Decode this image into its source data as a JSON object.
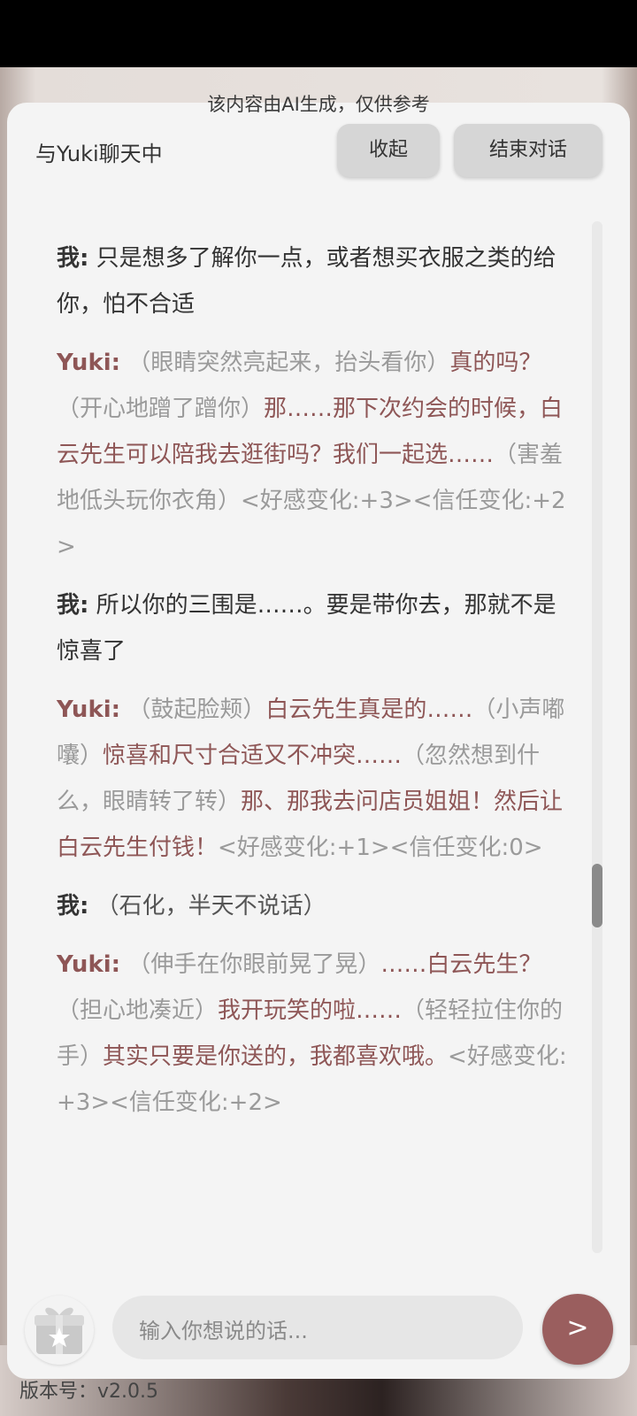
{
  "ai_notice": "该内容由AI生成，仅供参考",
  "header": {
    "title": "与Yuki聊天中",
    "collapse_label": "收起",
    "end_label": "结束对话"
  },
  "messages": [
    {
      "speaker": "我:",
      "role": "me",
      "parts": [
        {
          "type": "speech",
          "text": "只是想多了解你一点，或者想买衣服之类的给你，怕不合适"
        }
      ]
    },
    {
      "speaker": "Yuki:",
      "role": "yuki",
      "parts": [
        {
          "type": "action",
          "text": "（眼睛突然亮起来，抬头看你）"
        },
        {
          "type": "speech",
          "text": "真的吗？"
        },
        {
          "type": "action",
          "text": "（开心地蹭了蹭你）"
        },
        {
          "type": "speech",
          "text": "那……那下次约会的时候，白云先生可以陪我去逛街吗？我们一起选……"
        },
        {
          "type": "action",
          "text": "（害羞地低头玩你衣角）<好感变化:+3><信任变化:+2>"
        }
      ]
    },
    {
      "speaker": "我:",
      "role": "me",
      "parts": [
        {
          "type": "speech",
          "text": "所以你的三围是……。要是带你去，那就不是惊喜了"
        }
      ]
    },
    {
      "speaker": "Yuki:",
      "role": "yuki",
      "parts": [
        {
          "type": "action",
          "text": "（鼓起脸颊）"
        },
        {
          "type": "speech",
          "text": "白云先生真是的……"
        },
        {
          "type": "action",
          "text": "（小声嘟囔）"
        },
        {
          "type": "speech",
          "text": "惊喜和尺寸合适又不冲突……"
        },
        {
          "type": "action",
          "text": "（忽然想到什么，眼睛转了转）"
        },
        {
          "type": "speech",
          "text": "那、那我去问店员姐姐！然后让白云先生付钱！"
        },
        {
          "type": "action",
          "text": "<好感变化:+1><信任变化:0>"
        }
      ]
    },
    {
      "speaker": "我:",
      "role": "me",
      "parts": [
        {
          "type": "action",
          "text": "（石化，半天不说话）"
        }
      ]
    },
    {
      "speaker": "Yuki:",
      "role": "yuki",
      "parts": [
        {
          "type": "action",
          "text": "（伸手在你眼前晃了晃）"
        },
        {
          "type": "speech",
          "text": "……白云先生？"
        },
        {
          "type": "action",
          "text": "（担心地凑近）"
        },
        {
          "type": "speech",
          "text": "我开玩笑的啦……"
        },
        {
          "type": "action",
          "text": "（轻轻拉住你的手）"
        },
        {
          "type": "speech",
          "text": "其实只要是你送的，我都喜欢哦。"
        },
        {
          "type": "action",
          "text": "<好感变化:+3><信任变化:+2>"
        }
      ]
    }
  ],
  "input": {
    "placeholder": "输入你想说的话..."
  },
  "send_label": ">",
  "gift_icon": "gift-icon",
  "version": "版本号：v2.0.5",
  "colors": {
    "accent": "#9a5e5e",
    "yuki_text": "#8e5656",
    "action_text": "#9a9a9a",
    "panel_bg": "#f4f4f4"
  }
}
